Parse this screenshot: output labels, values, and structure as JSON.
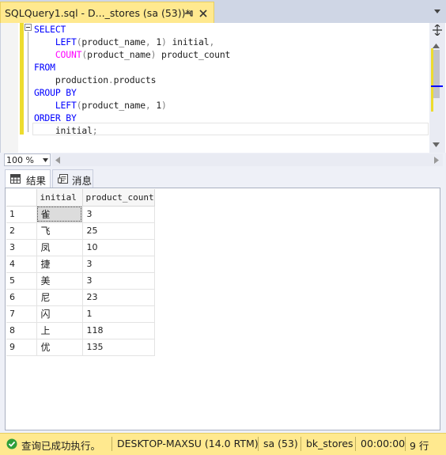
{
  "document_tab": {
    "title": "SQLQuery1.sql - D..._stores (sa (53))*"
  },
  "editor": {
    "lines": [
      [
        {
          "t": "kw",
          "v": "SELECT"
        }
      ],
      [
        {
          "t": "id",
          "v": "    "
        },
        {
          "t": "kw",
          "v": "LEFT"
        },
        {
          "t": "pn",
          "v": "("
        },
        {
          "t": "id",
          "v": "product_name"
        },
        {
          "t": "pn",
          "v": ", "
        },
        {
          "t": "id",
          "v": "1"
        },
        {
          "t": "pn",
          "v": ")"
        },
        {
          "t": "id",
          "v": " initial"
        },
        {
          "t": "pn",
          "v": ","
        }
      ],
      [
        {
          "t": "id",
          "v": "    "
        },
        {
          "t": "fn",
          "v": "COUNT"
        },
        {
          "t": "pn",
          "v": "("
        },
        {
          "t": "id",
          "v": "product_name"
        },
        {
          "t": "pn",
          "v": ")"
        },
        {
          "t": "id",
          "v": " product_count"
        }
      ],
      [
        {
          "t": "kw",
          "v": "FROM"
        }
      ],
      [
        {
          "t": "id",
          "v": "    production"
        },
        {
          "t": "pn",
          "v": "."
        },
        {
          "t": "id",
          "v": "products"
        }
      ],
      [
        {
          "t": "kw",
          "v": "GROUP BY"
        }
      ],
      [
        {
          "t": "id",
          "v": "    "
        },
        {
          "t": "kw",
          "v": "LEFT"
        },
        {
          "t": "pn",
          "v": "("
        },
        {
          "t": "id",
          "v": "product_name"
        },
        {
          "t": "pn",
          "v": ", "
        },
        {
          "t": "id",
          "v": "1"
        },
        {
          "t": "pn",
          "v": ")"
        }
      ],
      [
        {
          "t": "kw",
          "v": "ORDER BY"
        }
      ],
      [
        {
          "t": "id",
          "v": "    initial"
        },
        {
          "t": "pn",
          "v": ";"
        }
      ]
    ]
  },
  "zoom": {
    "value": "100 %"
  },
  "result_tabs": {
    "results_label": "结果",
    "messages_label": "消息"
  },
  "grid": {
    "columns": [
      "initial",
      "product_count"
    ],
    "rows": [
      {
        "num": "1",
        "initial": "雀",
        "count": "3"
      },
      {
        "num": "2",
        "initial": "飞",
        "count": "25"
      },
      {
        "num": "3",
        "initial": "凤",
        "count": "10"
      },
      {
        "num": "4",
        "initial": "捷",
        "count": "3"
      },
      {
        "num": "5",
        "initial": "美",
        "count": "3"
      },
      {
        "num": "6",
        "initial": "尼",
        "count": "23"
      },
      {
        "num": "7",
        "initial": "闪",
        "count": "1"
      },
      {
        "num": "8",
        "initial": "上",
        "count": "118"
      },
      {
        "num": "9",
        "initial": "优",
        "count": "135"
      }
    ]
  },
  "status": {
    "message": "查询已成功执行。",
    "server": "DESKTOP-MAXSU (14.0 RTM)",
    "user": "sa (53)",
    "database": "bk_stores",
    "elapsed": "00:00:00",
    "rows": "9 行"
  },
  "colors": {
    "keyword": "#0000ff",
    "function": "#ff00ff",
    "punctuation": "#808080",
    "tab_active": "#ffe98f",
    "status_bar": "#ffe98f",
    "success": "#2e9e3a"
  },
  "icons": {
    "pin": "pin-icon",
    "close": "close-icon",
    "results_tab": "grid-icon",
    "messages_tab": "messages-icon",
    "status": "success-check-icon"
  }
}
